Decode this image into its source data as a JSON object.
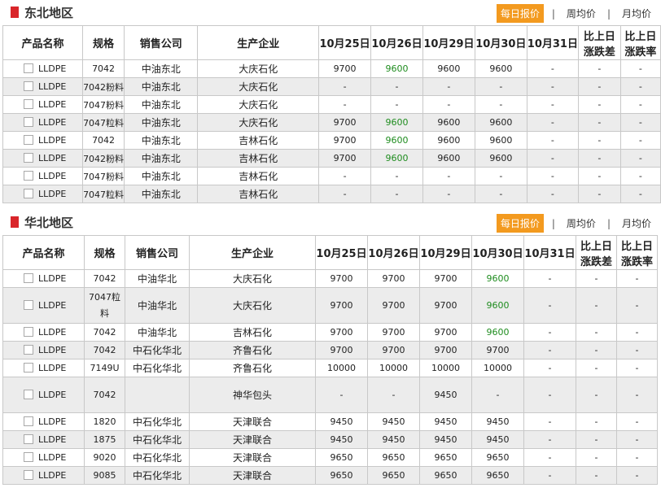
{
  "tabs": [
    "每日报价",
    "周均价",
    "月均价"
  ],
  "columns": [
    "产品名称",
    "规格",
    "销售公司",
    "生产企业",
    "10月25日",
    "10月26日",
    "10月29日",
    "10月30日",
    "10月31日",
    "比上日",
    "比上日"
  ],
  "columns_sub": [
    "涨跌差",
    "涨跌率"
  ],
  "colors": {
    "accent": "#f39a1f",
    "marker": "#d9252a",
    "up": "#1e8c1e"
  },
  "northeast": {
    "title": "东北地区",
    "rows": [
      [
        "LLDPE",
        "7042",
        "中油东北",
        "大庆石化",
        "9700",
        "9600",
        "9600",
        "9600",
        "-",
        "-",
        "-"
      ],
      [
        "LLDPE",
        "7042粉料",
        "中油东北",
        "大庆石化",
        "-",
        "-",
        "-",
        "-",
        "-",
        "-",
        "-"
      ],
      [
        "LLDPE",
        "7047粉料",
        "中油东北",
        "大庆石化",
        "-",
        "-",
        "-",
        "-",
        "-",
        "-",
        "-"
      ],
      [
        "LLDPE",
        "7047粒料",
        "中油东北",
        "大庆石化",
        "9700",
        "9600",
        "9600",
        "9600",
        "-",
        "-",
        "-"
      ],
      [
        "LLDPE",
        "7042",
        "中油东北",
        "吉林石化",
        "9700",
        "9600",
        "9600",
        "9600",
        "-",
        "-",
        "-"
      ],
      [
        "LLDPE",
        "7042粉料",
        "中油东北",
        "吉林石化",
        "9700",
        "9600",
        "9600",
        "9600",
        "-",
        "-",
        "-"
      ],
      [
        "LLDPE",
        "7047粉料",
        "中油东北",
        "吉林石化",
        "-",
        "-",
        "-",
        "-",
        "-",
        "-",
        "-"
      ],
      [
        "LLDPE",
        "7047粒料",
        "中油东北",
        "吉林石化",
        "-",
        "-",
        "-",
        "-",
        "-",
        "-",
        "-"
      ]
    ]
  },
  "north": {
    "title": "华北地区",
    "rows": [
      [
        "LLDPE",
        "7042",
        "中油华北",
        "大庆石化",
        "9700",
        "9700",
        "9700",
        "9600",
        "-",
        "-",
        "-"
      ],
      [
        "LLDPE",
        "7047粒料",
        "中油华北",
        "大庆石化",
        "9700",
        "9700",
        "9700",
        "9600",
        "-",
        "-",
        "-"
      ],
      [
        "LLDPE",
        "7042",
        "中油华北",
        "吉林石化",
        "9700",
        "9700",
        "9700",
        "9600",
        "-",
        "-",
        "-"
      ],
      [
        "LLDPE",
        "7042",
        "中石化华北",
        "齐鲁石化",
        "9700",
        "9700",
        "9700",
        "9700",
        "-",
        "-",
        "-"
      ],
      [
        "LLDPE",
        "7149U",
        "中石化华北",
        "齐鲁石化",
        "10000",
        "10000",
        "10000",
        "10000",
        "-",
        "-",
        "-"
      ],
      [
        "LLDPE",
        "7042",
        "",
        "神华包头",
        "-",
        "-",
        "9450",
        "-",
        "-",
        "-",
        "-"
      ],
      [
        "LLDPE",
        "1820",
        "中石化华北",
        "天津联合",
        "9450",
        "9450",
        "9450",
        "9450",
        "-",
        "-",
        "-"
      ],
      [
        "LLDPE",
        "1875",
        "中石化华北",
        "天津联合",
        "9450",
        "9450",
        "9450",
        "9450",
        "-",
        "-",
        "-"
      ],
      [
        "LLDPE",
        "9020",
        "中石化华北",
        "天津联合",
        "9650",
        "9650",
        "9650",
        "9650",
        "-",
        "-",
        "-"
      ],
      [
        "LLDPE",
        "9085",
        "中石化华北",
        "天津联合",
        "9650",
        "9650",
        "9650",
        "9650",
        "-",
        "-",
        "-"
      ]
    ]
  }
}
